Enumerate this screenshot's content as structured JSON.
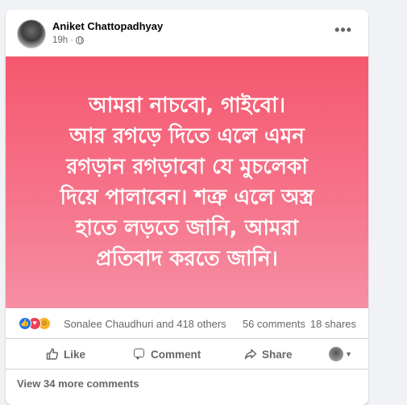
{
  "post": {
    "author": "Aniket Chattopadhyay",
    "time": "19h",
    "separator": "·",
    "more": "•••",
    "body_lines": [
      "আমরা নাচবো, গাইবো।",
      "আর রগড়ে দিতে এলে এমন",
      "রগড়ান রগড়াবো যে মুচলেকা",
      "দিয়ে পালাবেন। শত্রু এলে অস্ত্র",
      "হাতে লড়তে জানি, আমরা",
      "প্রতিবাদ করতে জানি।"
    ],
    "banner_colors": [
      "#f5586e",
      "#f68ea2"
    ]
  },
  "stats": {
    "reactions": [
      "like",
      "love",
      "haha"
    ],
    "reactors": "Sonalee Chaudhuri and 418 others",
    "comments": "56 comments",
    "shares": "18 shares"
  },
  "actions": {
    "like": "Like",
    "comment": "Comment",
    "share": "Share"
  },
  "view_more_comments": "View 34 more comments"
}
